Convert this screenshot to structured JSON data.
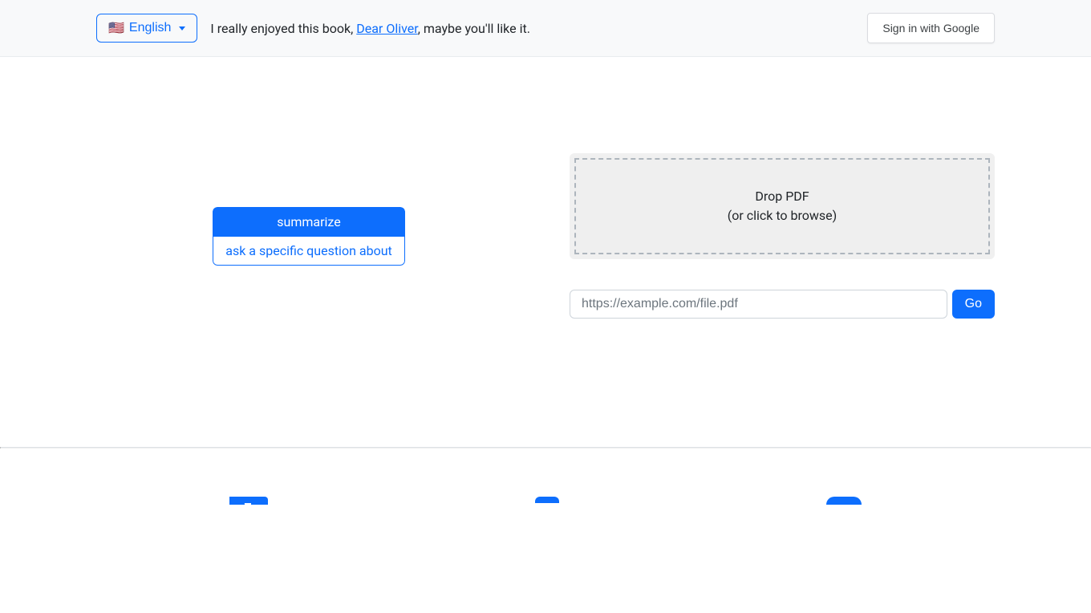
{
  "header": {
    "language_flag": "🇺🇸",
    "language_label": "English",
    "tagline_before": "I really enjoyed this book, ",
    "tagline_link": "Dear Oliver",
    "tagline_after": ", maybe you'll like it.",
    "signin_label": "Sign in with Google"
  },
  "actions": {
    "summarize": "summarize",
    "ask": "ask a specific question about"
  },
  "drop": {
    "line1": "Drop PDF",
    "line2": "(or click to browse)"
  },
  "url": {
    "placeholder": "https://example.com/file.pdf",
    "go": "Go"
  }
}
